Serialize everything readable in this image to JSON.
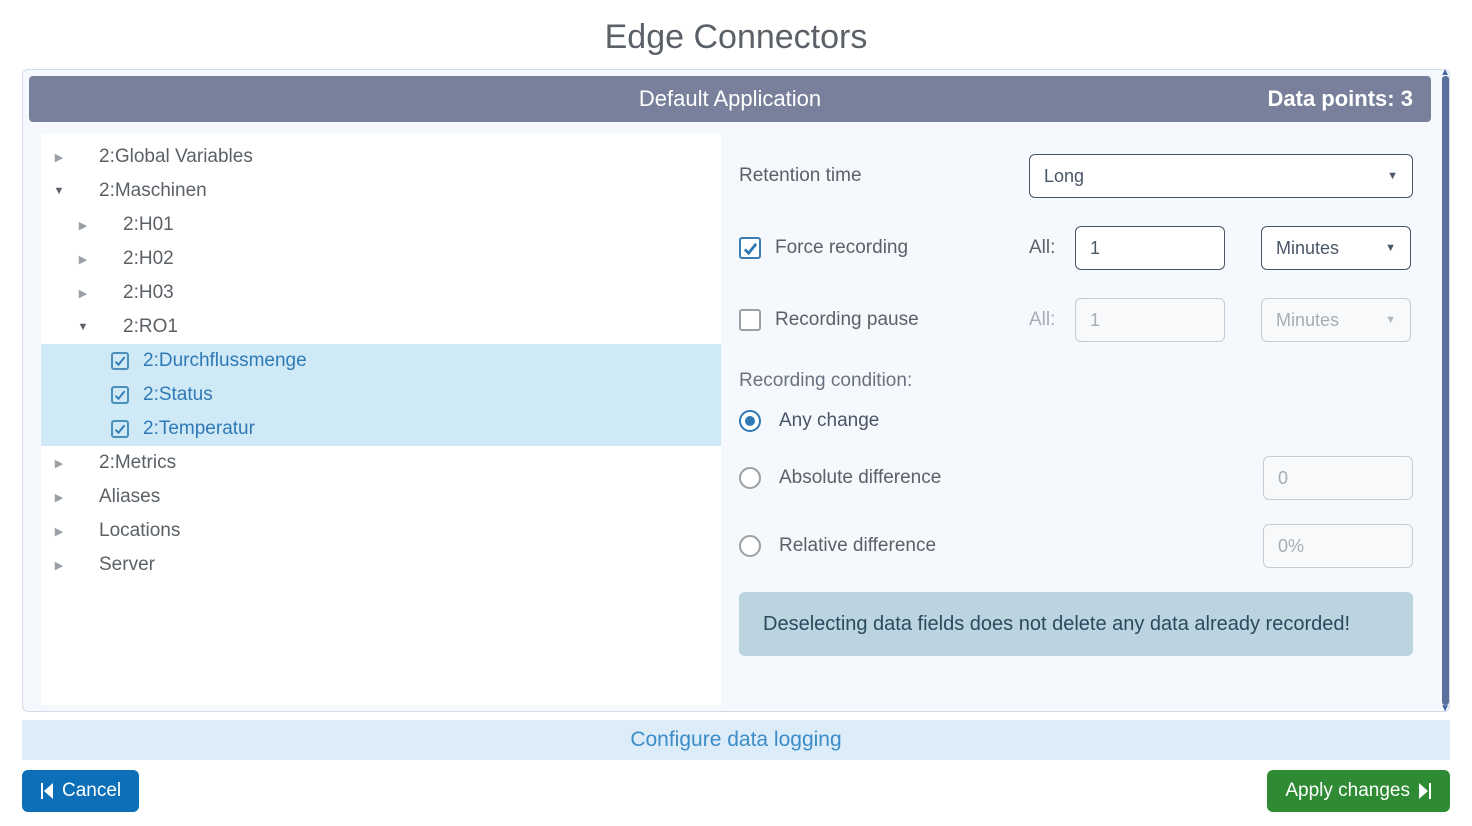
{
  "page_title": "Edge Connectors",
  "header": {
    "center": "Default Application",
    "datapoints_label": "Data points:",
    "datapoints_value": "3"
  },
  "tree": [
    {
      "depth": 0,
      "caret": "right",
      "label": "2:Global Variables",
      "selected": false,
      "checkbox": false
    },
    {
      "depth": 0,
      "caret": "down",
      "label": "2:Maschinen",
      "selected": false,
      "checkbox": false
    },
    {
      "depth": 1,
      "caret": "right",
      "label": "2:H01",
      "selected": false,
      "checkbox": false
    },
    {
      "depth": 1,
      "caret": "right",
      "label": "2:H02",
      "selected": false,
      "checkbox": false
    },
    {
      "depth": 1,
      "caret": "right",
      "label": "2:H03",
      "selected": false,
      "checkbox": false
    },
    {
      "depth": 1,
      "caret": "down",
      "label": "2:RO1",
      "selected": false,
      "checkbox": false
    },
    {
      "depth": 3,
      "caret": "",
      "label": "2:Durchflussmenge",
      "selected": true,
      "checkbox": true
    },
    {
      "depth": 3,
      "caret": "",
      "label": "2:Status",
      "selected": true,
      "checkbox": true
    },
    {
      "depth": 3,
      "caret": "",
      "label": "2:Temperatur",
      "selected": true,
      "checkbox": true
    },
    {
      "depth": 0,
      "caret": "right",
      "label": "2:Metrics",
      "selected": false,
      "checkbox": false
    },
    {
      "depth": 0,
      "caret": "right",
      "label": "Aliases",
      "selected": false,
      "checkbox": false
    },
    {
      "depth": 0,
      "caret": "right",
      "label": "Locations",
      "selected": false,
      "checkbox": false
    },
    {
      "depth": 0,
      "caret": "right",
      "label": "Server",
      "selected": false,
      "checkbox": false
    }
  ],
  "form": {
    "retention_label": "Retention time",
    "retention_value": "Long",
    "force_recording_label": "Force recording",
    "force_recording_checked": true,
    "force_all_label": "All:",
    "force_value": "1",
    "force_unit": "Minutes",
    "pause_label": "Recording pause",
    "pause_checked": false,
    "pause_all_label": "All:",
    "pause_value": "1",
    "pause_unit": "Minutes",
    "condition_label": "Recording condition:",
    "radio_any_change": "Any change",
    "radio_abs_diff": "Absolute difference",
    "radio_abs_value": "0",
    "radio_rel_diff": "Relative difference",
    "radio_rel_value": "0%",
    "info_banner": "Deselecting data fields does not delete any data already recorded!"
  },
  "footer": {
    "configure_link": "Configure data logging",
    "cancel": "Cancel",
    "apply": "Apply changes"
  }
}
